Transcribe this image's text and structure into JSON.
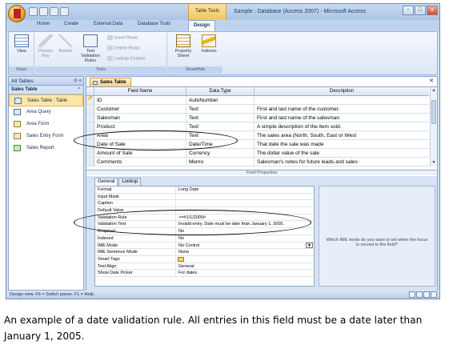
{
  "window": {
    "title": "Sample : Database (Access 2007) - Microsoft Access",
    "contextual_tab_group": "Table Tools",
    "controls": [
      "-",
      "□",
      "x"
    ]
  },
  "ribbon": {
    "tabs": [
      "Home",
      "Create",
      "External Data",
      "Database Tools",
      "Design"
    ],
    "active_tab": "Design",
    "groups": {
      "views": {
        "label": "Views",
        "view_label": "View"
      },
      "tools": {
        "label": "Tools",
        "primary_key": "Primary Key",
        "builder": "Builder",
        "test_validation_rules": "Test Validation Rules",
        "insert_rows": "Insert Rows",
        "delete_rows": "Delete Rows",
        "lookup_column": "Lookup Column"
      },
      "show_hide": {
        "label": "Show/Hide",
        "property_sheet": "Property Sheet",
        "indexes": "Indexes"
      }
    }
  },
  "nav_pane": {
    "header": "All Tables",
    "group": "Sales Table",
    "items": [
      {
        "label": "Sales Table : Table",
        "type": "table",
        "selected": true
      },
      {
        "label": "Area Query",
        "type": "query"
      },
      {
        "label": "Area Form",
        "type": "form"
      },
      {
        "label": "Sales Entry Form",
        "type": "form"
      },
      {
        "label": "Sales Report",
        "type": "report"
      }
    ]
  },
  "document": {
    "tab_label": "Sales Table",
    "columns": [
      "Field Name",
      "Data Type",
      "Description"
    ],
    "fields": [
      {
        "name": "ID",
        "type": "AutoNumber",
        "description": "",
        "key": true
      },
      {
        "name": "Customer",
        "type": "Text",
        "description": "First and last name of the customer."
      },
      {
        "name": "Salesman",
        "type": "Text",
        "description": "First and last name of the salesman"
      },
      {
        "name": "Product",
        "type": "Text",
        "description": "A simple description of the item sold."
      },
      {
        "name": "Area",
        "type": "Text",
        "description": "The sales area (North, South, East or West"
      },
      {
        "name": "Date of Sale",
        "type": "Date/Time",
        "description": "That date the sale was made"
      },
      {
        "name": "Amount of Sale",
        "type": "Currency",
        "description": "The dollar value of the sale"
      },
      {
        "name": "Comments",
        "type": "Memo",
        "description": "Salesman's notes for future leads and sales"
      }
    ],
    "field_properties_label": "Field Properties"
  },
  "properties": {
    "tabs": [
      "General",
      "Lookup"
    ],
    "active_tab": "General",
    "rows": [
      {
        "key": "Format",
        "value": "Long Date"
      },
      {
        "key": "Input Mask",
        "value": ""
      },
      {
        "key": "Caption",
        "value": ""
      },
      {
        "key": "Default Value",
        "value": ""
      },
      {
        "key": "Validation Rule",
        "value": ">=#1/1/2005#"
      },
      {
        "key": "Validation Text",
        "value": "Invalid entry. Date must be later than January 1, 2005."
      },
      {
        "key": "Required",
        "value": "No"
      },
      {
        "key": "Indexed",
        "value": "No"
      },
      {
        "key": "IME Mode",
        "value": "No Control"
      },
      {
        "key": "IME Sentence Mode",
        "value": "None"
      },
      {
        "key": "Smart Tags",
        "value": ""
      },
      {
        "key": "Text Align",
        "value": "General"
      },
      {
        "key": "Show Date Picker",
        "value": "For dates"
      }
    ],
    "help_text": "Which IME mode do you want to set when the focus is moved to the field?"
  },
  "status_bar": {
    "text": "Design view.  F6 = Switch panes.  F1 = Help."
  },
  "caption": "An example of a date validation rule. All entries in this field must be a date later than January 1, 2005."
}
